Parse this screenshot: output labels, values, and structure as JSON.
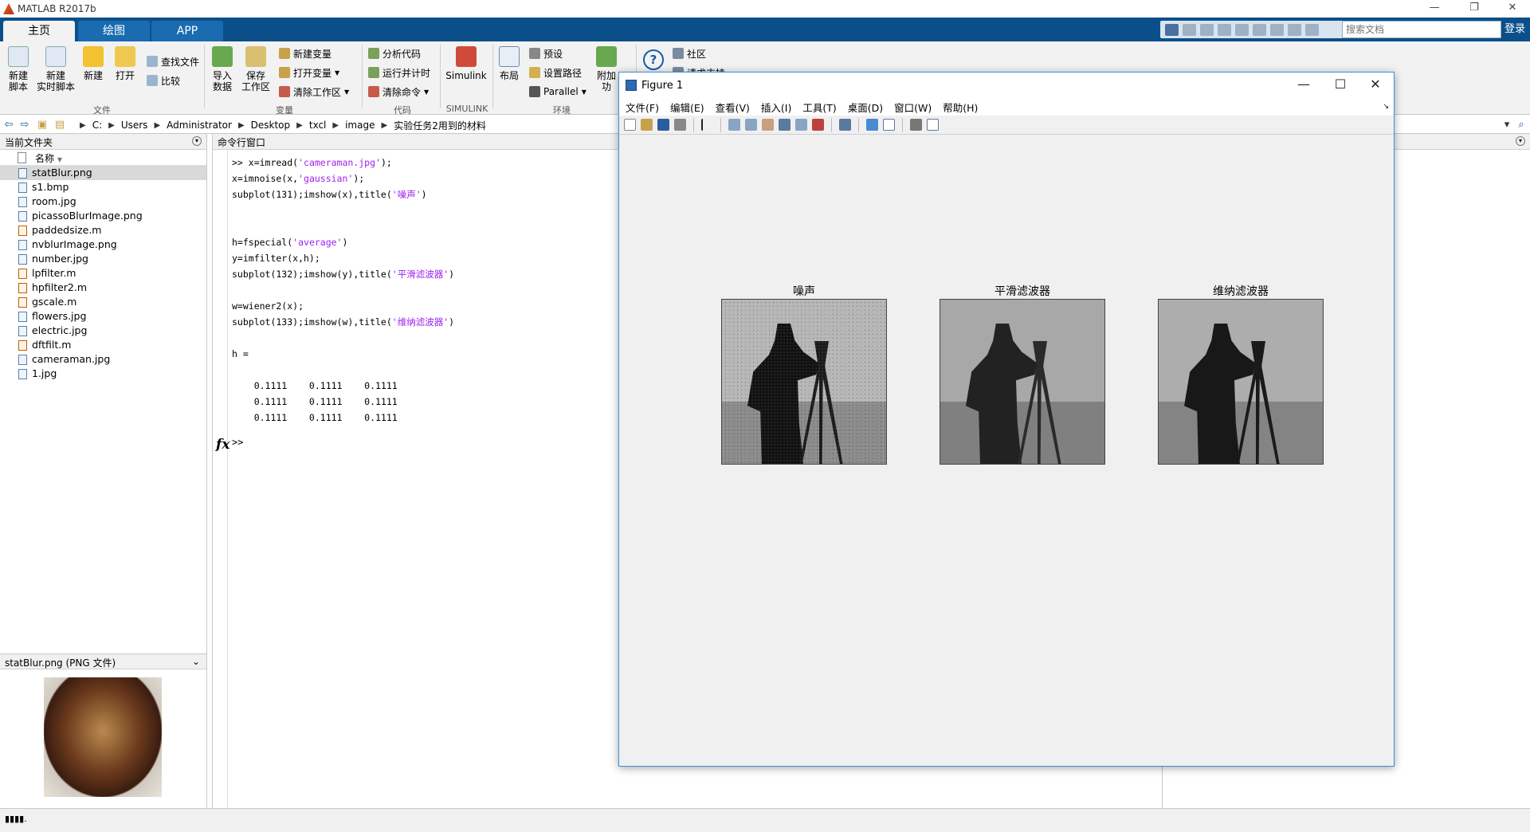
{
  "window": {
    "title": "MATLAB R2017b"
  },
  "tabs": [
    {
      "label": "主页"
    },
    {
      "label": "绘图"
    },
    {
      "label": "APP"
    }
  ],
  "search": {
    "placeholder": "搜索文档"
  },
  "login": "登录",
  "ribbon": {
    "new_script": "新建\n脚本",
    "new_live_script": "新建\n实时脚本",
    "new": "新建",
    "open": "打开",
    "find_files": "查找文件",
    "compare": "比较",
    "import_data": "导入\n数据",
    "save_workspace": "保存\n工作区",
    "new_variable": "新建变量",
    "open_variable": "打开变量",
    "clear_workspace": "清除工作区",
    "analyze_code": "分析代码",
    "run_and_time": "运行并计时",
    "clear_commands": "清除命令",
    "simulink": "Simulink",
    "layout": "布局",
    "preferences": "预设",
    "set_path": "设置路径",
    "parallel": "Parallel",
    "addons": "附加功",
    "help": "?",
    "community": "社区",
    "request_support": "请求支持",
    "groups": {
      "file": "文件",
      "variable": "变量",
      "code": "代码",
      "simulink": "SIMULINK",
      "environment": "环境"
    }
  },
  "path": [
    "C:",
    "Users",
    "Administrator",
    "Desktop",
    "txcl",
    "image",
    "实验任务2用到的材料"
  ],
  "current_folder": {
    "title": "当前文件夹",
    "column_name": "名称",
    "files": [
      {
        "name": "statBlur.png",
        "type": "img"
      },
      {
        "name": "s1.bmp",
        "type": "img"
      },
      {
        "name": "room.jpg",
        "type": "img"
      },
      {
        "name": "picassoBlurImage.png",
        "type": "img"
      },
      {
        "name": "paddedsize.m",
        "type": "m"
      },
      {
        "name": "nvblurImage.png",
        "type": "img"
      },
      {
        "name": "number.jpg",
        "type": "img"
      },
      {
        "name": "lpfilter.m",
        "type": "m"
      },
      {
        "name": "hpfilter2.m",
        "type": "m"
      },
      {
        "name": "gscale.m",
        "type": "m"
      },
      {
        "name": "flowers.jpg",
        "type": "img"
      },
      {
        "name": "electric.jpg",
        "type": "img"
      },
      {
        "name": "dftfilt.m",
        "type": "m"
      },
      {
        "name": "cameraman.jpg",
        "type": "img"
      },
      {
        "name": "1.jpg",
        "type": "img"
      }
    ],
    "selected": "statBlur.png",
    "details_title": "statBlur.png  (PNG 文件)"
  },
  "command_window": {
    "title": "命令行窗口",
    "lines": [
      [
        ">> x=imread(",
        "'cameraman.jpg'",
        ");"
      ],
      [
        "x=imnoise(x,",
        "'gaussian'",
        ");"
      ],
      [
        "subplot(131);imshow(x),title(",
        "'噪声'",
        ")"
      ],
      [
        "",
        "",
        ""
      ],
      [
        "",
        "",
        ""
      ],
      [
        "h=fspecial(",
        "'average'",
        ")"
      ],
      [
        "y=imfilter(x,h);",
        "",
        ""
      ],
      [
        "subplot(132);imshow(y),title(",
        "'平滑滤波器'",
        ")"
      ],
      [
        "",
        "",
        ""
      ],
      [
        "w=wiener2(x);",
        "",
        ""
      ],
      [
        "subplot(133);imshow(w),title(",
        "'维纳滤波器'",
        ")"
      ],
      [
        "",
        "",
        ""
      ],
      [
        "h =",
        "",
        ""
      ],
      [
        "",
        "",
        ""
      ],
      [
        "    0.1111    0.1111    0.1111",
        "",
        ""
      ],
      [
        "    0.1111    0.1111    0.1111",
        "",
        ""
      ],
      [
        "    0.1111    0.1111    0.1111",
        "",
        ""
      ]
    ],
    "fx": "fx",
    "prompt": ">>"
  },
  "figure": {
    "title": "Figure 1",
    "menu": [
      "文件(F)",
      "编辑(E)",
      "查看(V)",
      "插入(I)",
      "工具(T)",
      "桌面(D)",
      "窗口(W)",
      "帮助(H)"
    ],
    "subplots": [
      {
        "title": "噪声"
      },
      {
        "title": "平滑滤波器"
      },
      {
        "title": "维纳滤波器"
      }
    ]
  },
  "colors": {
    "tabstrip": "#0b4f8a",
    "string": "#a020f0",
    "accent": "#3c8fd8"
  }
}
